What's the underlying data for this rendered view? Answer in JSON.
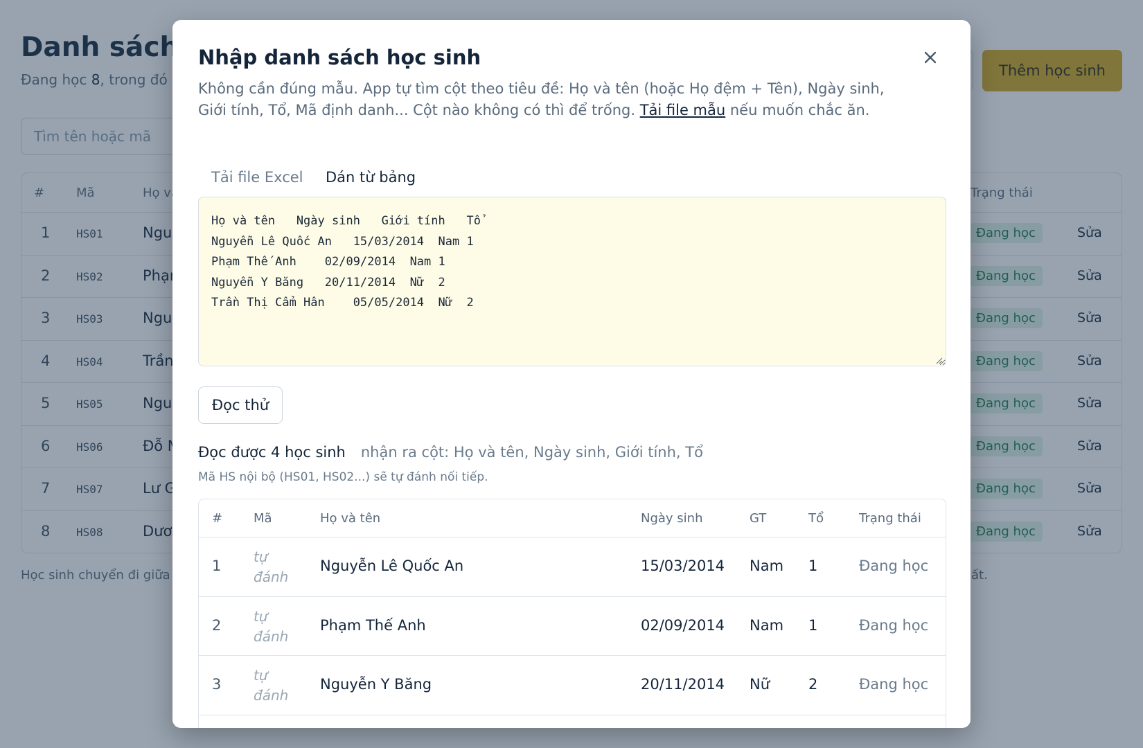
{
  "background": {
    "title": "Danh sách",
    "subtitle_prefix": "Đang học ",
    "subtitle_count": "8",
    "subtitle_suffix": ", trong đó",
    "search_placeholder": "Tìm tên hoặc mã",
    "add_button": "Thêm học sinh",
    "table": {
      "headers": {
        "num": "#",
        "code": "Mã",
        "name": "Họ và",
        "status": "Trạng thái"
      },
      "rows": [
        {
          "num": "1",
          "code": "HS01",
          "name": "Nguy",
          "status": "Đang học",
          "edit": "Sửa"
        },
        {
          "num": "2",
          "code": "HS02",
          "name": "Phạm",
          "status": "Đang học",
          "edit": "Sửa"
        },
        {
          "num": "3",
          "code": "HS03",
          "name": "Nguy",
          "status": "Đang học",
          "edit": "Sửa"
        },
        {
          "num": "4",
          "code": "HS04",
          "name": "Trần",
          "status": "Đang học",
          "edit": "Sửa"
        },
        {
          "num": "5",
          "code": "HS05",
          "name": "Nguy",
          "status": "Đang học",
          "edit": "Sửa"
        },
        {
          "num": "6",
          "code": "HS06",
          "name": "Đỗ M",
          "status": "Đang học",
          "edit": "Sửa"
        },
        {
          "num": "7",
          "code": "HS07",
          "name": "Lư G",
          "status": "Đang học",
          "edit": "Sửa"
        },
        {
          "num": "8",
          "code": "HS08",
          "name": "Dươ",
          "status": "Đang học",
          "edit": "Sửa"
        }
      ]
    },
    "footer_left": "Học sinh chuyển đi giữa",
    "footer_right": "ất."
  },
  "modal": {
    "title": "Nhập danh sách học sinh",
    "description": "Không cần đúng mẫu. App tự tìm cột theo tiêu đề: Họ và tên (hoặc Họ đệm + Tên), Ngày sinh, Giới tính, Tổ, Mã định danh... Cột nào không có thì để trống. ",
    "template_link": "Tải file mẫu",
    "description_end": " nếu muốn chắc ăn.",
    "tabs": [
      {
        "label": "Tải file Excel",
        "active": false
      },
      {
        "label": "Dán từ bảng",
        "active": true
      }
    ],
    "paste_text": "Họ và tên   Ngày sinh   Giới tính   Tổ\nNguyễn Lê Quốc An   15/03/2014  Nam 1\nPhạm Thế Anh    02/09/2014  Nam 1\nNguyễn Y Băng   20/11/2014  Nữ  2\nTrần Thị Cẩm Hân    05/05/2014  Nữ  2",
    "parse_button": "Đọc thử",
    "result_count": "Đọc được 4 học sinh",
    "result_columns": "nhận ra cột: Họ và tên, Ngày sinh, Giới tính, Tổ",
    "result_note": "Mã HS nội bộ (HS01, HS02...) sẽ tự đánh nối tiếp.",
    "preview": {
      "headers": {
        "num": "#",
        "code": "Mã",
        "name": "Họ và tên",
        "dob": "Ngày sinh",
        "gender": "GT",
        "group": "Tổ",
        "status": "Trạng thái"
      },
      "rows": [
        {
          "num": "1",
          "code": "tự đánh",
          "name": "Nguyễn Lê Quốc An",
          "dob": "15/03/2014",
          "gender": "Nam",
          "group": "1",
          "status": "Đang học"
        },
        {
          "num": "2",
          "code": "tự đánh",
          "name": "Phạm Thế Anh",
          "dob": "02/09/2014",
          "gender": "Nam",
          "group": "1",
          "status": "Đang học"
        },
        {
          "num": "3",
          "code": "tự đánh",
          "name": "Nguyễn Y Băng",
          "dob": "20/11/2014",
          "gender": "Nữ",
          "group": "2",
          "status": "Đang học"
        }
      ]
    }
  },
  "colors": {
    "accent_gold": "#d1a81f",
    "paste_bg": "#fefbe6",
    "status_green": "#1f7a52"
  }
}
